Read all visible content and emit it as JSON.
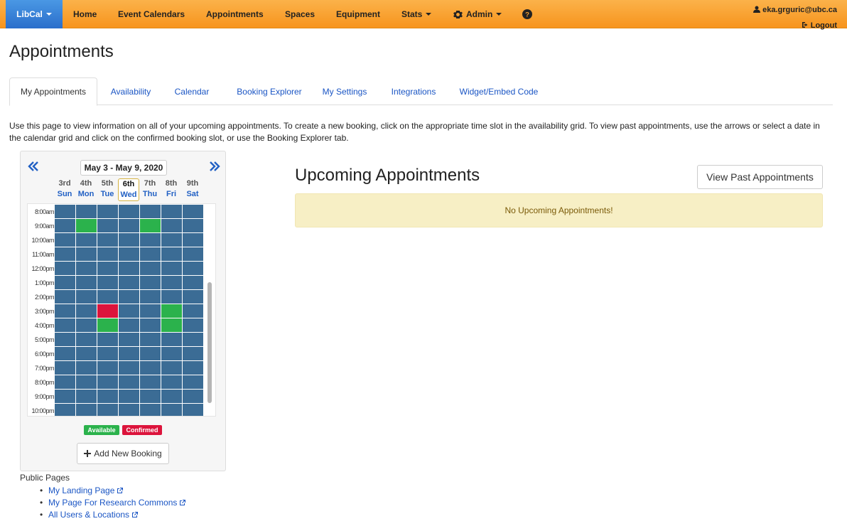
{
  "colors": {
    "nav_bg": "#f7941d",
    "brand_bg": "#2a6ecb",
    "slot_default": "#3b6c95",
    "slot_available": "#2bb24c",
    "slot_confirmed": "#dc143c",
    "alert_bg": "#f7efc5",
    "link": "#1a55c4"
  },
  "topnav": {
    "brand": "LibCal",
    "items": [
      {
        "label": "Home",
        "has_caret": false
      },
      {
        "label": "Event Calendars",
        "has_caret": false
      },
      {
        "label": "Appointments",
        "has_caret": false
      },
      {
        "label": "Spaces",
        "has_caret": false
      },
      {
        "label": "Equipment",
        "has_caret": false
      },
      {
        "label": "Stats",
        "has_caret": true
      },
      {
        "label": "Admin",
        "has_caret": true,
        "icon": "gear-icon"
      }
    ],
    "help_icon": "question-circle-icon",
    "user_email": "eka.grguric@ubc.ca",
    "logout": "Logout"
  },
  "page_title": "Appointments",
  "tabs": [
    "My Appointments",
    "Availability",
    "Calendar",
    "Booking Explorer",
    "My Settings",
    "Integrations",
    "Widget/Embed Code"
  ],
  "active_tab": "My Appointments",
  "intro_text": "Use this page to view information on all of your upcoming appointments. To create a new booking, click on the appropriate time slot in the availability grid. To view past appointments, use the arrows or select a date in the calendar grid and click on the confirmed booking slot, or use the Booking Explorer tab.",
  "calendar": {
    "prev_icon": "double-chevron-left-icon",
    "next_icon": "double-chevron-right-icon",
    "week_range": "May 3 - May 9, 2020",
    "days": [
      {
        "num": "3rd",
        "name": "Sun"
      },
      {
        "num": "4th",
        "name": "Mon"
      },
      {
        "num": "5th",
        "name": "Tue"
      },
      {
        "num": "6th",
        "name": "Wed",
        "today": true
      },
      {
        "num": "7th",
        "name": "Thu"
      },
      {
        "num": "8th",
        "name": "Fri"
      },
      {
        "num": "9th",
        "name": "Sat"
      }
    ],
    "times": [
      "8:00am",
      "9:00am",
      "10:00am",
      "11:00am",
      "12:00pm",
      "1:00pm",
      "2:00pm",
      "3:00pm",
      "4:00pm",
      "5:00pm",
      "6:00pm",
      "7:00pm",
      "8:00pm",
      "9:00pm",
      "10:00pm"
    ],
    "available_slots": [
      {
        "day": "Mon",
        "time": "9:00am"
      },
      {
        "day": "Thu",
        "time": "9:00am"
      },
      {
        "day": "Fri",
        "time": "3:00pm"
      },
      {
        "day": "Tue",
        "time": "4:00pm"
      },
      {
        "day": "Fri",
        "time": "4:00pm"
      }
    ],
    "confirmed_slots": [
      {
        "day": "Tue",
        "time": "3:00pm"
      }
    ],
    "legend_available": "Available",
    "legend_confirmed": "Confirmed",
    "add_button": "Add New Booking",
    "add_icon": "plus-icon"
  },
  "public_pages": {
    "title": "Public Pages",
    "links": [
      "My Landing Page",
      "My Page For Research Commons",
      "All Users & Locations"
    ],
    "link_icon": "external-link-icon"
  },
  "upcoming": {
    "title": "Upcoming Appointments",
    "past_button": "View Past Appointments",
    "empty_message": "No Upcoming Appointments!"
  }
}
